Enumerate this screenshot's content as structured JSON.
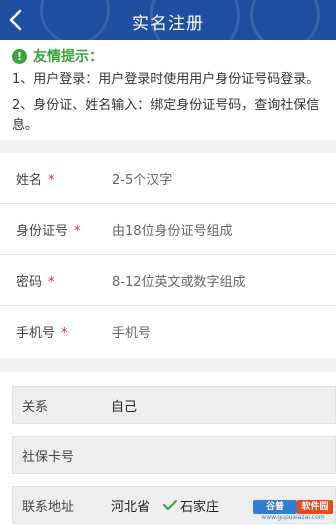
{
  "header": {
    "title": "实名注册",
    "back_icon": "chevron-left-icon"
  },
  "tips": {
    "icon": "info-icon",
    "heading": "友情提示：",
    "line1": "1、用户登录：用户登录时使用用户身份证号码登录。",
    "line2": "2、身份证、姓名输入：绑定身份证号码，查询社保信息。"
  },
  "form": {
    "name": {
      "label": "姓名",
      "required": "*",
      "placeholder": "2-5个汉字"
    },
    "id_number": {
      "label": "身份证号",
      "required": "*",
      "placeholder": "由18位身份证号组成"
    },
    "password": {
      "label": "密码",
      "required": "*",
      "placeholder": "8-12位英文或数字组成"
    },
    "phone": {
      "label": "手机号",
      "required": "*",
      "placeholder": "手机号"
    }
  },
  "extra": {
    "relation": {
      "label": "关系",
      "value": "自己"
    },
    "social_card": {
      "label": "社保卡号",
      "value": ""
    },
    "address": {
      "label": "联系地址",
      "province": "河北省",
      "city": "石家庄"
    }
  },
  "watermark": {
    "brand_a": "谷普",
    "brand_b": "软件园",
    "url": "www.gupuxiazai.com"
  },
  "colors": {
    "header": "#1e4fa1",
    "tip_green": "#3aa43a",
    "required_red": "#d9322b"
  }
}
